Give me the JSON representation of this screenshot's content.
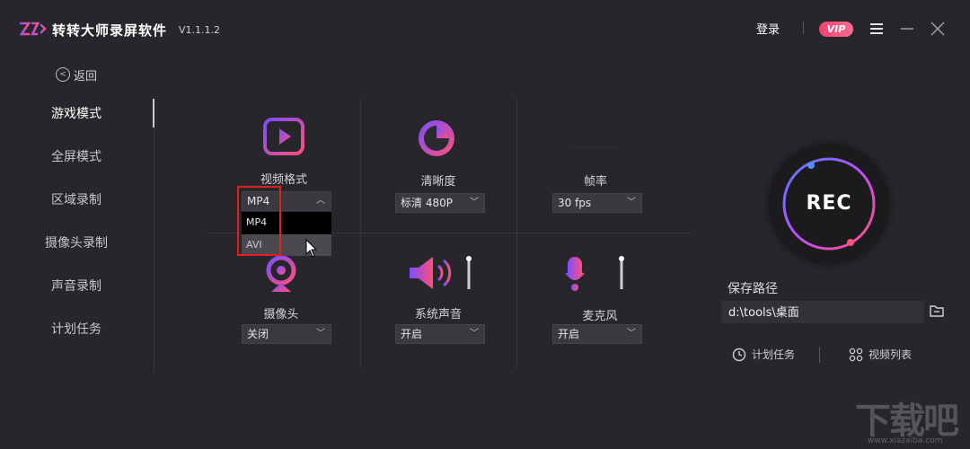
{
  "window": {
    "app_title": "转转大师录屏软件",
    "version": "V1.1.1.2",
    "login_label": "登录",
    "vip_label": "VIP"
  },
  "sidebar": {
    "back_label": "返回",
    "items": [
      {
        "label": "游戏模式"
      },
      {
        "label": "全屏模式"
      },
      {
        "label": "区域录制"
      },
      {
        "label": "摄像头录制"
      },
      {
        "label": "声音录制"
      },
      {
        "label": "计划任务"
      }
    ]
  },
  "settings": {
    "video_format": {
      "label": "视频格式",
      "value": "MP4",
      "options": [
        "MP4",
        "AVI"
      ]
    },
    "clarity": {
      "label": "清晰度",
      "value": "标清 480P"
    },
    "frame_rate": {
      "label": "帧率",
      "value": "30 fps"
    },
    "camera": {
      "label": "摄像头",
      "value": "关闭"
    },
    "system_audio": {
      "label": "系统声音",
      "value": "开启"
    },
    "microphone": {
      "label": "麦克风",
      "value": "开启"
    }
  },
  "record": {
    "button_label": "REC"
  },
  "save": {
    "label": "保存路径",
    "path": "d:\\tools\\桌面"
  },
  "bottom": {
    "schedule_label": "计划任务",
    "video_list_label": "视频列表"
  },
  "watermark": {
    "text": "下载吧",
    "url": "www.xiazaiba.com"
  },
  "colors": {
    "accent_pink": "#f0426f",
    "accent_purple": "#7b4dff",
    "background": "#27262b"
  }
}
